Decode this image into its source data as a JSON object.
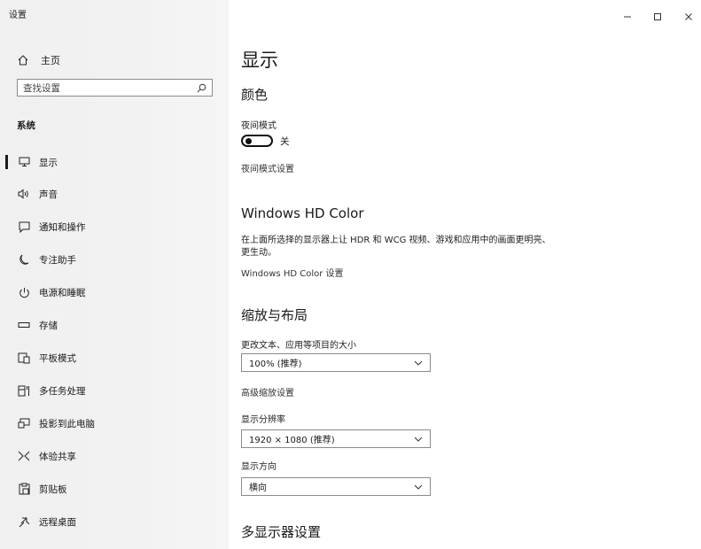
{
  "window": {
    "title": "设置",
    "minimize_icon": "minimize-icon",
    "maximize_icon": "maximize-icon",
    "close_icon": "close-icon"
  },
  "sidebar": {
    "home": {
      "label": "主页",
      "icon": "home-icon"
    },
    "search": {
      "placeholder": "查找设置",
      "icon": "search-icon"
    },
    "section": "系统",
    "items": [
      {
        "label": "显示",
        "icon": "monitor-icon",
        "selected": true
      },
      {
        "label": "声音",
        "icon": "speaker-icon"
      },
      {
        "label": "通知和操作",
        "icon": "notification-icon"
      },
      {
        "label": "专注助手",
        "icon": "moon-icon"
      },
      {
        "label": "电源和睡眠",
        "icon": "power-icon"
      },
      {
        "label": "存储",
        "icon": "storage-icon"
      },
      {
        "label": "平板模式",
        "icon": "tablet-icon"
      },
      {
        "label": "多任务处理",
        "icon": "multitask-icon"
      },
      {
        "label": "投影到此电脑",
        "icon": "project-icon"
      },
      {
        "label": "体验共享",
        "icon": "share-icon"
      },
      {
        "label": "剪贴板",
        "icon": "clipboard-icon"
      },
      {
        "label": "远程桌面",
        "icon": "remote-desktop-icon"
      }
    ]
  },
  "main": {
    "title": "显示",
    "color": {
      "heading": "颜色",
      "night_mode_label": "夜间模式",
      "night_mode_state": "关",
      "night_mode_on": false,
      "night_mode_settings": "夜间模式设置"
    },
    "hdr": {
      "heading": "Windows HD Color",
      "description": "在上面所选择的显示器上让 HDR 和 WCG 视频、游戏和应用中的画面更明亮、更生动。",
      "settings_link": "Windows HD Color 设置"
    },
    "scale": {
      "heading": "缩放与布局",
      "text_size_label": "更改文本、应用等项目的大小",
      "text_size_value": "100% (推荐)",
      "advanced_link": "高级缩放设置",
      "resolution_label": "显示分辨率",
      "resolution_value": "1920 × 1080 (推荐)",
      "orientation_label": "显示方向",
      "orientation_value": "横向"
    },
    "multi_display": {
      "heading": "多显示器设置"
    }
  }
}
